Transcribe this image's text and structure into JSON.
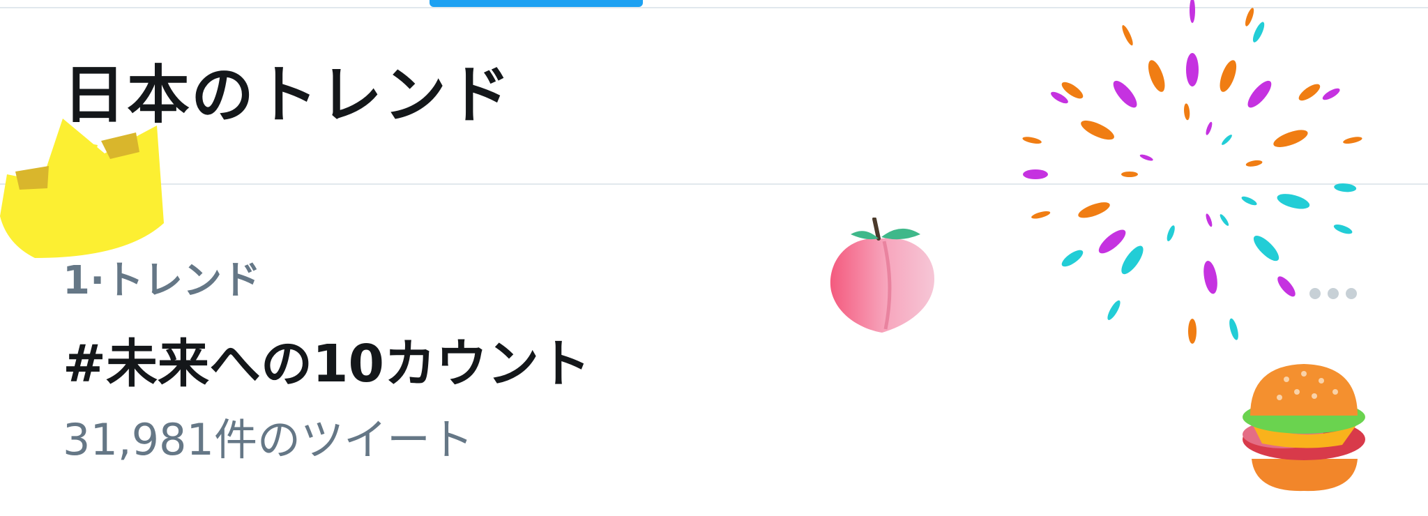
{
  "section": {
    "title": "日本のトレンド"
  },
  "trend": {
    "meta": "1·トレンド",
    "name": "#未来への10カウント",
    "count": "31,981件のツイート"
  },
  "stickers": [
    "crown-icon",
    "peach-icon",
    "burger-icon",
    "fireworks-icon"
  ],
  "colors": {
    "accent": "#1da1f2",
    "primary_text": "#14171a",
    "secondary_text": "#657786",
    "divider": "#e1e8ed"
  }
}
